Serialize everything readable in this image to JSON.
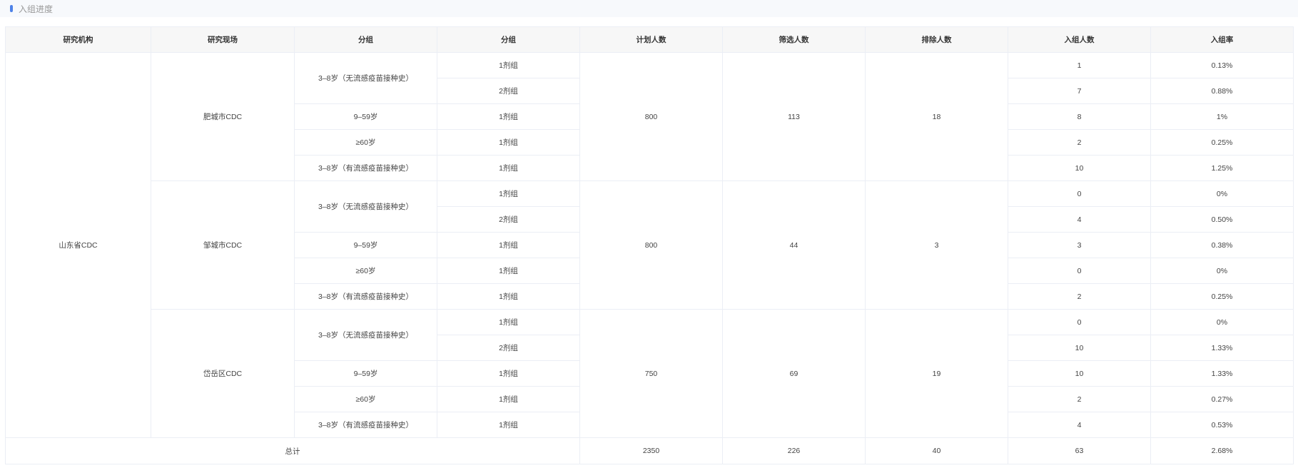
{
  "section": {
    "title": "入组进度"
  },
  "table": {
    "headers": [
      "研究机构",
      "研究现场",
      "分组",
      "分组",
      "计划人数",
      "筛选人数",
      "排除人数",
      "入组人数",
      "入组率"
    ],
    "institution": "山东省CDC",
    "sites": [
      {
        "name": "肥城市CDC",
        "planned": "800",
        "screened": "113",
        "excluded": "18",
        "groups": [
          {
            "name": "3–8岁（无流感疫苗接种史）",
            "doses": [
              {
                "dose": "1剂组",
                "enrolled": "1",
                "rate": "0.13%"
              },
              {
                "dose": "2剂组",
                "enrolled": "7",
                "rate": "0.88%"
              }
            ]
          },
          {
            "name": "9–59岁",
            "doses": [
              {
                "dose": "1剂组",
                "enrolled": "8",
                "rate": "1%"
              }
            ]
          },
          {
            "name": "≥60岁",
            "doses": [
              {
                "dose": "1剂组",
                "enrolled": "2",
                "rate": "0.25%"
              }
            ]
          },
          {
            "name": "3–8岁（有流感疫苗接种史）",
            "doses": [
              {
                "dose": "1剂组",
                "enrolled": "10",
                "rate": "1.25%"
              }
            ]
          }
        ]
      },
      {
        "name": "邹城市CDC",
        "planned": "800",
        "screened": "44",
        "excluded": "3",
        "groups": [
          {
            "name": "3–8岁（无流感疫苗接种史）",
            "doses": [
              {
                "dose": "1剂组",
                "enrolled": "0",
                "rate": "0%"
              },
              {
                "dose": "2剂组",
                "enrolled": "4",
                "rate": "0.50%"
              }
            ]
          },
          {
            "name": "9–59岁",
            "doses": [
              {
                "dose": "1剂组",
                "enrolled": "3",
                "rate": "0.38%"
              }
            ]
          },
          {
            "name": "≥60岁",
            "doses": [
              {
                "dose": "1剂组",
                "enrolled": "0",
                "rate": "0%"
              }
            ]
          },
          {
            "name": "3–8岁（有流感疫苗接种史）",
            "doses": [
              {
                "dose": "1剂组",
                "enrolled": "2",
                "rate": "0.25%"
              }
            ]
          }
        ]
      },
      {
        "name": "岱岳区CDC",
        "planned": "750",
        "screened": "69",
        "excluded": "19",
        "groups": [
          {
            "name": "3–8岁（无流感疫苗接种史）",
            "doses": [
              {
                "dose": "1剂组",
                "enrolled": "0",
                "rate": "0%"
              },
              {
                "dose": "2剂组",
                "enrolled": "10",
                "rate": "1.33%"
              }
            ]
          },
          {
            "name": "9–59岁",
            "doses": [
              {
                "dose": "1剂组",
                "enrolled": "10",
                "rate": "1.33%"
              }
            ]
          },
          {
            "name": "≥60岁",
            "doses": [
              {
                "dose": "1剂组",
                "enrolled": "2",
                "rate": "0.27%"
              }
            ]
          },
          {
            "name": "3–8岁（有流感疫苗接种史）",
            "doses": [
              {
                "dose": "1剂组",
                "enrolled": "4",
                "rate": "0.53%"
              }
            ]
          }
        ]
      }
    ],
    "total": {
      "label": "总计",
      "planned": "2350",
      "screened": "226",
      "excluded": "40",
      "enrolled": "63",
      "rate": "2.68%"
    }
  }
}
